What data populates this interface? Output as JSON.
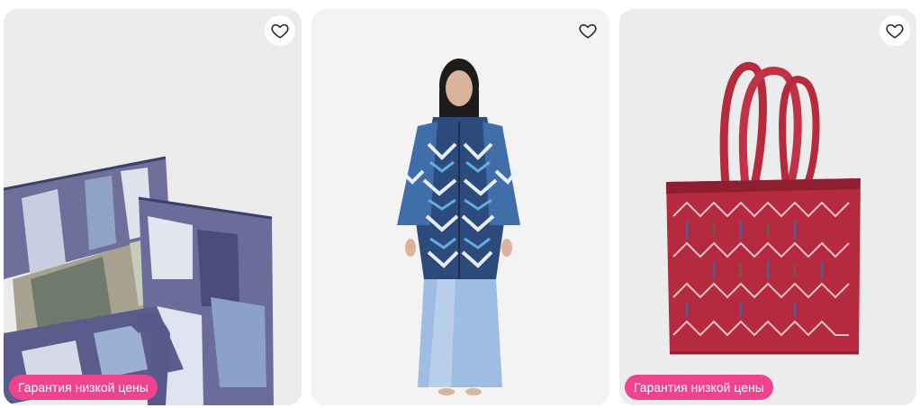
{
  "products": [
    {
      "image_icon": "ikat-tote-bag-closeup-image",
      "favorite_icon": "heart-outline-icon",
      "badge": "Гарантия низкой цены"
    },
    {
      "image_icon": "ikat-coat-model-image",
      "favorite_icon": "heart-outline-icon",
      "badge": null
    },
    {
      "image_icon": "red-ikat-tote-bag-image",
      "favorite_icon": "heart-outline-icon",
      "badge": "Гарантия низкой цены"
    }
  ],
  "colors": {
    "badge_bg": "#f0438f",
    "badge_text": "#ffffff",
    "heart_stroke": "#1f1f1f"
  }
}
